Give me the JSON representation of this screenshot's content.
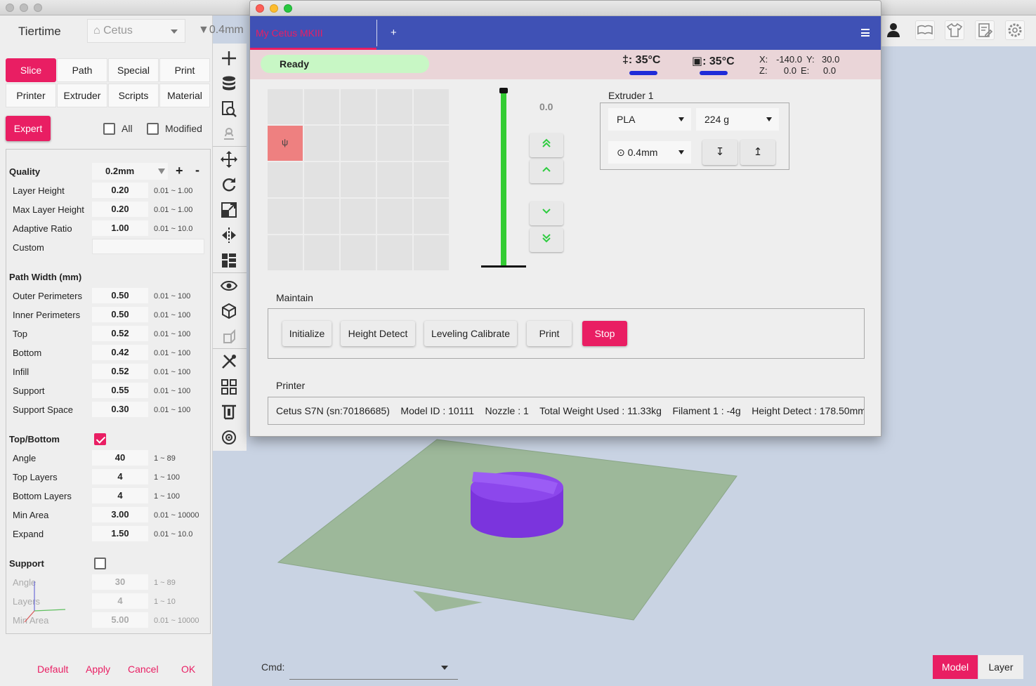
{
  "main_window": {
    "app_title": "Tiertime",
    "printer_select": "⌂ Cetus",
    "nozzle_label": "▼0.4mm"
  },
  "tabs": {
    "row1": [
      "Slice",
      "Path",
      "Special",
      "Print"
    ],
    "row2": [
      "Printer",
      "Extruder",
      "Scripts",
      "Material"
    ],
    "active": "Slice"
  },
  "mode": {
    "expert_label": "Expert",
    "all_label": "All",
    "modified_label": "Modified"
  },
  "quality": {
    "title": "Quality",
    "preset": "0.2mm",
    "add": "+",
    "remove": "-",
    "params": [
      {
        "label": "Layer Height",
        "value": "0.20",
        "range": "0.01 ~ 1.00"
      },
      {
        "label": "Max Layer Height",
        "value": "0.20",
        "range": "0.01 ~ 1.00"
      },
      {
        "label": "Adaptive Ratio",
        "value": "1.00",
        "range": "0.01 ~ 10.0"
      }
    ],
    "custom_label": "Custom"
  },
  "path_width": {
    "title": "Path Width (mm)",
    "params": [
      {
        "label": "Outer Perimeters",
        "value": "0.50",
        "range": "0.01 ~ 100"
      },
      {
        "label": "Inner Perimeters",
        "value": "0.50",
        "range": "0.01 ~ 100"
      },
      {
        "label": "Top",
        "value": "0.52",
        "range": "0.01 ~ 100"
      },
      {
        "label": "Bottom",
        "value": "0.42",
        "range": "0.01 ~ 100"
      },
      {
        "label": "Infill",
        "value": "0.52",
        "range": "0.01 ~ 100"
      },
      {
        "label": "Support",
        "value": "0.55",
        "range": "0.01 ~ 100"
      },
      {
        "label": "Support Space",
        "value": "0.30",
        "range": "0.01 ~ 100"
      }
    ]
  },
  "top_bottom": {
    "title": "Top/Bottom",
    "enabled": true,
    "params": [
      {
        "label": "Angle",
        "value": "40",
        "range": "1 ~ 89"
      },
      {
        "label": "Top Layers",
        "value": "4",
        "range": "1 ~ 100"
      },
      {
        "label": "Bottom Layers",
        "value": "4",
        "range": "1 ~ 100"
      },
      {
        "label": "Min Area",
        "value": "3.00",
        "range": "0.01 ~ 10000"
      },
      {
        "label": "Expand",
        "value": "1.50",
        "range": "0.01 ~ 10.0"
      }
    ]
  },
  "support": {
    "title": "Support",
    "enabled": false,
    "params": [
      {
        "label": "Angle",
        "value": "30",
        "range": "1 ~ 89"
      },
      {
        "label": "Layers",
        "value": "4",
        "range": "1 ~ 10"
      },
      {
        "label": "Min Area",
        "value": "5.00",
        "range": "0.01 ~ 10000"
      }
    ]
  },
  "footer": {
    "default": "Default",
    "apply": "Apply",
    "cancel": "Cancel",
    "ok": "OK"
  },
  "toolbar_icons": [
    "add-icon",
    "database-icon",
    "preview-icon",
    "slice-icon",
    "move-icon",
    "rotate-icon",
    "scale-icon",
    "mirror-icon",
    "layout-icon",
    "eye-icon",
    "cube-icon",
    "view-side-icon",
    "tools-icon",
    "grid-icon",
    "calibrate-icon",
    "target-icon"
  ],
  "right_bar_icons": [
    "user-icon",
    "book-icon",
    "shirt-icon",
    "report-icon",
    "settings-icon"
  ],
  "viewport": {
    "cmd_label": "Cmd:",
    "model_btn": "Model",
    "layer_btn": "Layer",
    "model_color": "#7e3fe0",
    "bed_color": "#9db89a"
  },
  "dialog": {
    "tab_label": "My Cetus MKIII",
    "add_tab": "+",
    "status": "Ready",
    "nozzle_temp": "‡: 35°C",
    "bed_temp": "▣: 35°C",
    "coords": {
      "x_label": "X:",
      "x": "-140.0",
      "y_label": "Y:",
      "y": "30.0",
      "z_label": "Z:",
      "z": "0.0",
      "e_label": "E:",
      "e": "0.0"
    },
    "home_glyph": "ψ",
    "z_value": "0.0",
    "z_buttons": [
      "⌃⌃",
      "⌃",
      "⌄",
      "⌄⌄"
    ],
    "extruder": {
      "title": "Extruder 1",
      "material": "PLA",
      "weight": "224 g",
      "nozzle": "⊙ 0.4mm",
      "unload": "↧",
      "load": "↥"
    },
    "maintain": {
      "title": "Maintain",
      "buttons": [
        "Initialize",
        "Height Detect",
        "Leveling Calibrate",
        "Print",
        "Stop"
      ]
    },
    "printer": {
      "title": "Printer",
      "info": "Cetus S7N (sn:70186685)    Model ID : 10111    Nozzle : 1    Total Weight Used : 11.33kg    Filament 1 : -4g    Height Detect : 178.50mm"
    },
    "colors": {
      "header": "#3f51b5",
      "accent": "#e91e63",
      "ready": "#c8f7c5",
      "status_bg": "#ead5d8",
      "z_track": "#33cc33"
    }
  }
}
